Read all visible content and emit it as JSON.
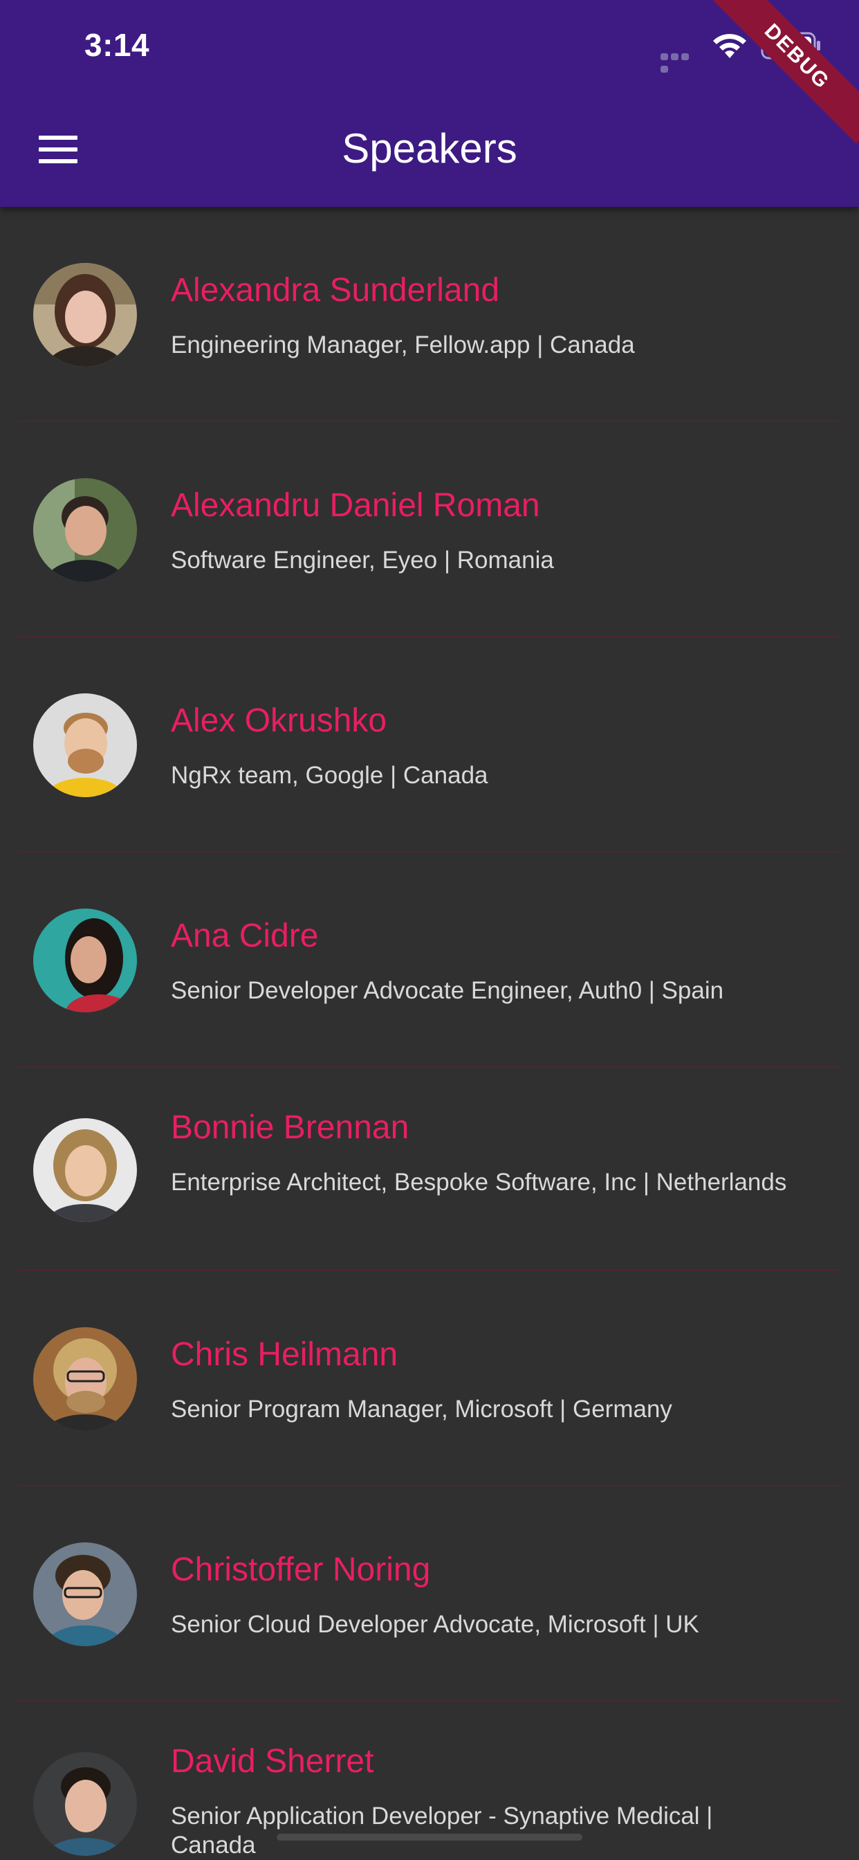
{
  "status_bar": {
    "time": "3:14"
  },
  "app_bar": {
    "title": "Speakers",
    "menu_icon": "hamburger-menu-icon",
    "background": "#3d1b82"
  },
  "debug_banner": {
    "label": "DEBUG",
    "color": "#8b1437"
  },
  "accent_color": "#e91e63",
  "speakers": [
    {
      "name": "Alexandra Sunderland",
      "subtitle": "Engineering Manager, Fellow.app | Canada"
    },
    {
      "name": "Alexandru Daniel Roman",
      "subtitle": "Software Engineer, Eyeo | Romania"
    },
    {
      "name": "Alex Okrushko",
      "subtitle": "NgRx team, Google | Canada"
    },
    {
      "name": "Ana Cidre",
      "subtitle": "Senior Developer Advocate Engineer, Auth0 | Spain"
    },
    {
      "name": "Bonnie Brennan",
      "subtitle": "Enterprise Architect, Bespoke Software, Inc | Netherlands"
    },
    {
      "name": "Chris Heilmann",
      "subtitle": "Senior Program Manager, Microsoft | Germany"
    },
    {
      "name": "Christoffer Noring",
      "subtitle": "Senior Cloud Developer Advocate, Microsoft | UK"
    },
    {
      "name": "David Sherret",
      "subtitle": "Senior Application Developer - Synaptive Medical | Canada"
    }
  ]
}
